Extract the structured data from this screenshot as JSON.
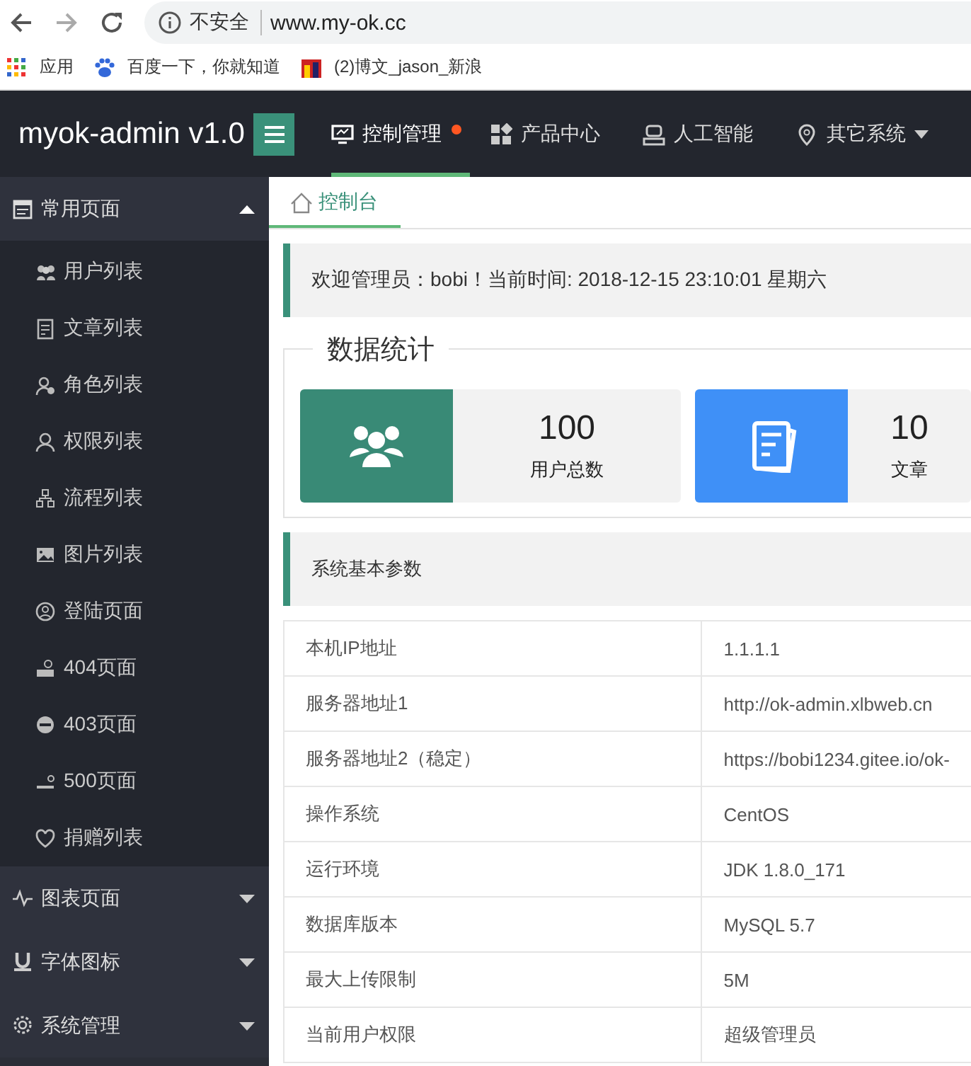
{
  "browser": {
    "security": "不安全",
    "url": "www.my-ok.cc"
  },
  "bookmarks": [
    {
      "label": "应用"
    },
    {
      "label": "百度一下，你就知道"
    },
    {
      "label": "(2)博文_jason_新浪"
    }
  ],
  "header": {
    "logo": "myok-admin v1.0",
    "nav": [
      {
        "label": "控制管理",
        "selected": true,
        "badge": true,
        "dropdown": false
      },
      {
        "label": "产品中心",
        "selected": false,
        "badge": false,
        "dropdown": false
      },
      {
        "label": "人工智能",
        "selected": false,
        "badge": false,
        "dropdown": false
      },
      {
        "label": "其它系统",
        "selected": false,
        "badge": false,
        "dropdown": true
      }
    ]
  },
  "sidebar": {
    "groups": [
      {
        "label": "常用页面",
        "expanded": true,
        "children": [
          {
            "label": "用户列表"
          },
          {
            "label": "文章列表"
          },
          {
            "label": "角色列表"
          },
          {
            "label": "权限列表"
          },
          {
            "label": "流程列表"
          },
          {
            "label": "图片列表"
          },
          {
            "label": "登陆页面"
          },
          {
            "label": "404页面"
          },
          {
            "label": "403页面"
          },
          {
            "label": "500页面"
          },
          {
            "label": "捐赠列表"
          }
        ]
      },
      {
        "label": "图表页面",
        "expanded": false
      },
      {
        "label": "字体图标",
        "expanded": false
      },
      {
        "label": "系统管理",
        "expanded": false
      }
    ]
  },
  "tabs": [
    {
      "label": "控制台",
      "selected": true
    }
  ],
  "welcome": "欢迎管理员：bobi！当前时间: 2018-12-15 23:10:01 星期六",
  "stats": {
    "title": "数据统计",
    "cards": [
      {
        "value": "100",
        "label": "用户总数",
        "color": "#398a76"
      },
      {
        "value": "10",
        "label": "文章",
        "color": "#3f90f7"
      }
    ]
  },
  "params": {
    "title": "系统基本参数",
    "rows": [
      [
        "本机IP地址",
        "1.1.1.1"
      ],
      [
        "服务器地址1",
        "http://ok-admin.xlbweb.cn"
      ],
      [
        "服务器地址2（稳定）",
        "https://bobi1234.gitee.io/ok-"
      ],
      [
        "操作系统",
        "CentOS"
      ],
      [
        "运行环境",
        "JDK 1.8.0_171"
      ],
      [
        "数据库版本",
        "MySQL 5.7"
      ],
      [
        "最大上传限制",
        "5M"
      ],
      [
        "当前用户权限",
        "超级管理员"
      ]
    ]
  }
}
